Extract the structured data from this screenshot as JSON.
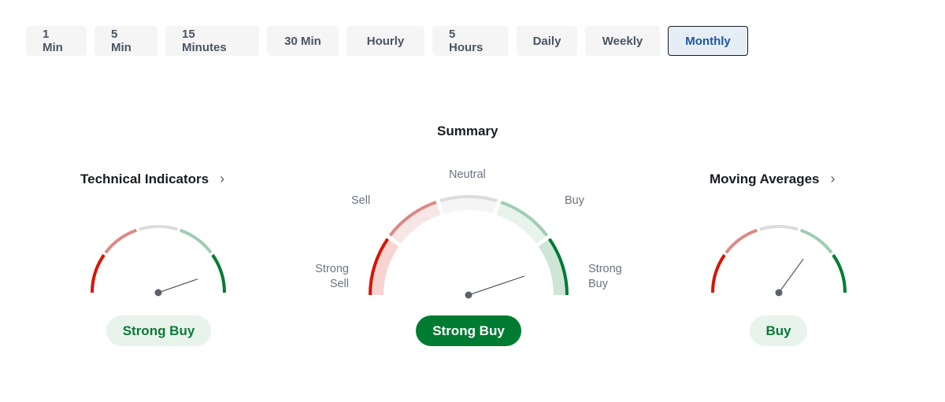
{
  "timeframes": {
    "items": [
      {
        "label": "1 Min",
        "active": false
      },
      {
        "label": "5 Min",
        "active": false
      },
      {
        "label": "15 Minutes",
        "active": false
      },
      {
        "label": "30 Min",
        "active": false
      },
      {
        "label": "Hourly",
        "active": false
      },
      {
        "label": "5 Hours",
        "active": false
      },
      {
        "label": "Daily",
        "active": false
      },
      {
        "label": "Weekly",
        "active": false
      },
      {
        "label": "Monthly",
        "active": true
      }
    ]
  },
  "summary": {
    "title": "Summary",
    "labels": {
      "strong_sell": "Strong\nSell",
      "sell": "Sell",
      "neutral": "Neutral",
      "buy": "Buy",
      "strong_buy": "Strong\nBuy"
    },
    "needle_fraction": 0.896,
    "result": "Strong Buy"
  },
  "technical_indicators": {
    "title": "Technical Indicators",
    "chevron_icon": "chevron-right-icon",
    "needle_fraction": 0.894,
    "result": "Strong Buy"
  },
  "moving_averages": {
    "title": "Moving Averages",
    "chevron_icon": "chevron-right-icon",
    "needle_fraction": 0.7,
    "result": "Buy"
  },
  "colors": {
    "strong_sell": "#d91400",
    "sell": "#dc8a87",
    "neutral": "#dcdcdc",
    "buy": "#9fcdb2",
    "strong_buy": "#007c32",
    "strong_sell_fill": "#f7d4d1",
    "sell_fill": "#f7e6e6",
    "neutral_fill": "#f5f5f5",
    "buy_fill": "#e8f3ec",
    "strong_buy_fill": "#cde6d7",
    "needle": "#5b616e"
  }
}
